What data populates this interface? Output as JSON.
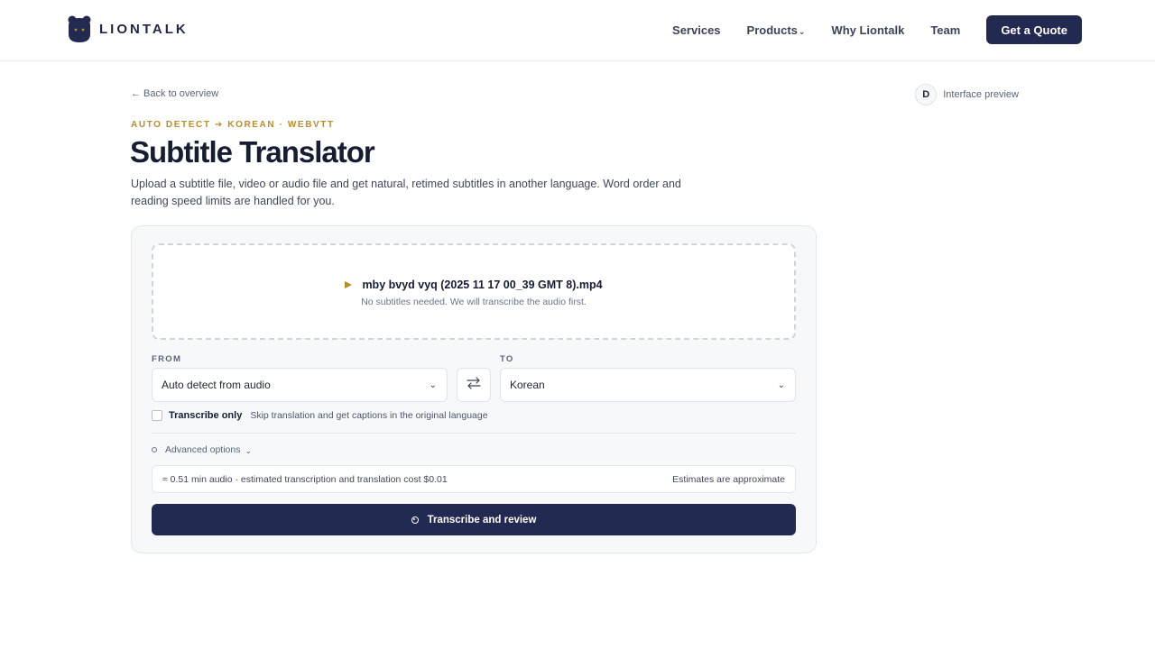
{
  "brand": {
    "name": "LIONTALK",
    "color": "#222a52",
    "accent": "#bb8c2a"
  },
  "nav": {
    "items": [
      {
        "label": "Services"
      },
      {
        "label": "Products",
        "has_dropdown": true
      },
      {
        "label": "Why Liontalk"
      },
      {
        "label": "Team"
      }
    ],
    "cta_label": "Get a Quote"
  },
  "page": {
    "back_link": "← Back to overview",
    "preview_avatar": "D",
    "preview_label": "Interface preview",
    "eyebrow": "AUTO DETECT ➔ KOREAN · WEBVTT",
    "title": "Subtitle Translator",
    "description": "Upload a subtitle file, video or audio file and get natural, retimed subtitles in another language. Word order and reading speed limits are handled for you."
  },
  "upload": {
    "file_name": "mby bvyd vyq (2025 11 17 00_39 GMT 8).mp4",
    "file_note": "No subtitles needed. We will transcribe the audio first.",
    "file_icon": "play-icon"
  },
  "languages": {
    "from_label": "FROM",
    "from_value": "Auto detect from audio",
    "to_label": "TO",
    "to_value": "Korean",
    "swap_icon": "swap-icon"
  },
  "options": {
    "transcribe_only_label": "Transcribe only",
    "transcribe_only_hint": "Skip translation and get captions in the original language",
    "transcribe_only_checked": false,
    "advanced_label": "Advanced options"
  },
  "estimate": {
    "summary": "≈ 0.51 min audio · estimated transcription and translation cost $0.01",
    "note": "Estimates are approximate"
  },
  "submit": {
    "label": "Transcribe and review"
  }
}
